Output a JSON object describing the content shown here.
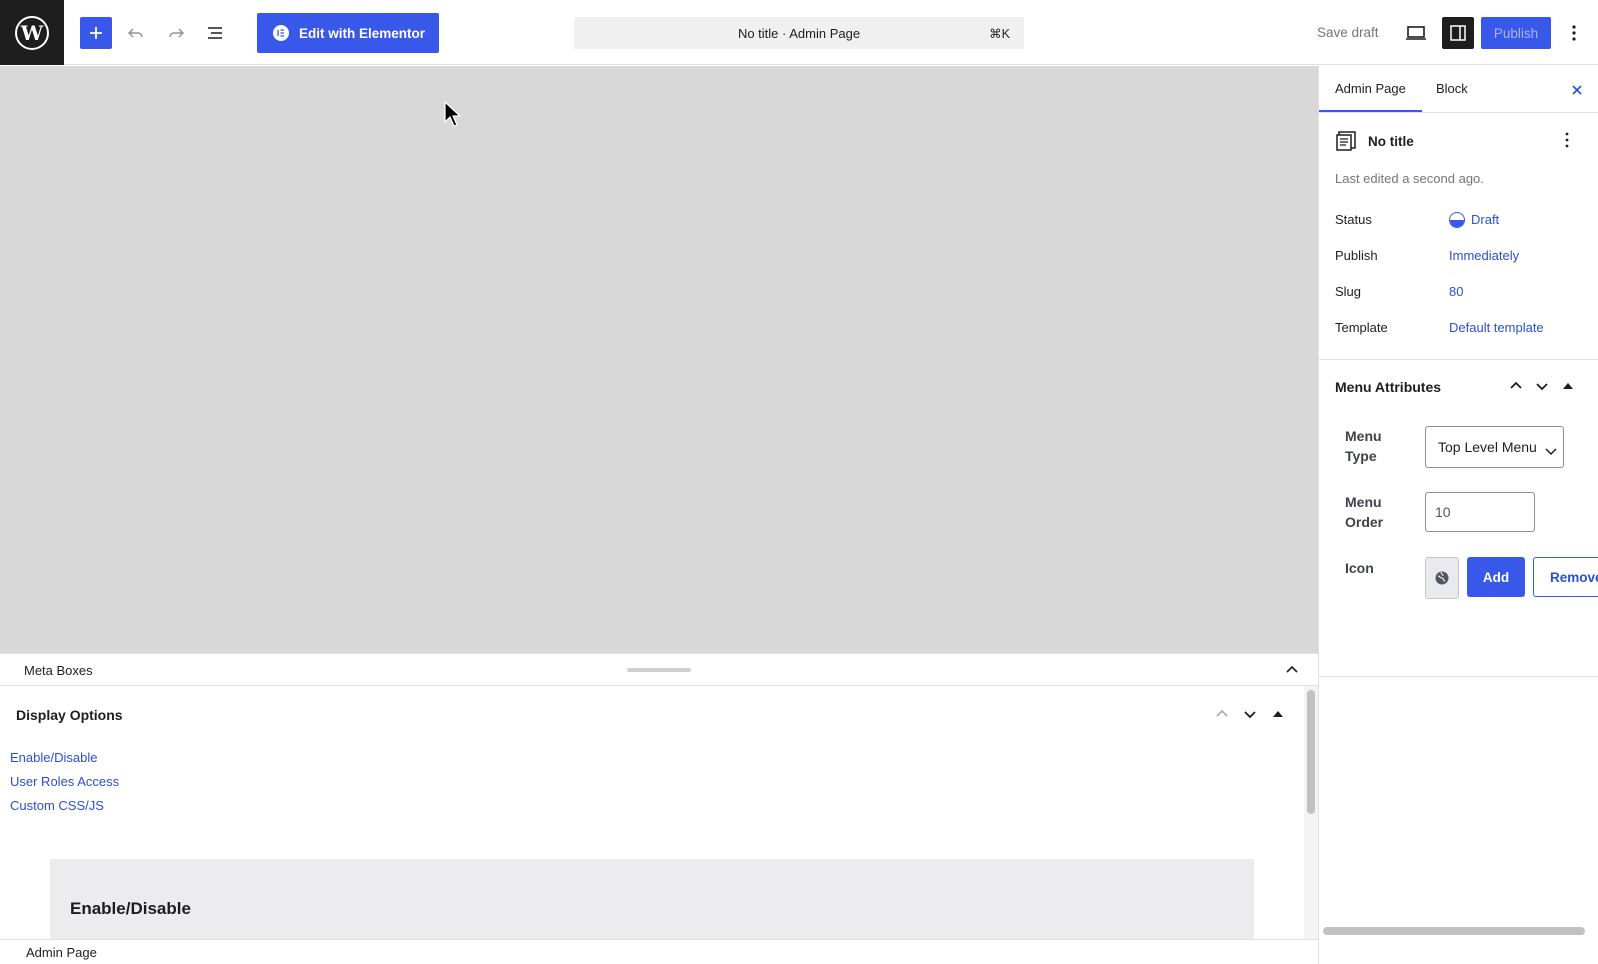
{
  "header": {
    "elementor_label": "Edit with Elementor",
    "command_bar": {
      "title": "No title · Admin Page",
      "shortcut": "⌘K"
    },
    "save_draft": "Save draft",
    "publish": "Publish"
  },
  "meta_boxes": {
    "title": "Meta Boxes",
    "panel": {
      "title": "Display Options",
      "links": [
        "Enable/Disable",
        "User Roles Access",
        "Custom CSS/JS"
      ],
      "section_heading": "Enable/Disable"
    }
  },
  "footer": {
    "breadcrumb": "Admin Page"
  },
  "sidebar": {
    "tabs": [
      "Admin Page",
      "Block"
    ],
    "active_tab": "Admin Page",
    "document": {
      "title": "No title",
      "last_edited": "Last edited a second ago."
    },
    "properties": [
      {
        "label": "Status",
        "value": "Draft"
      },
      {
        "label": "Publish",
        "value": "Immediately"
      },
      {
        "label": "Slug",
        "value": "80"
      },
      {
        "label": "Template",
        "value": "Default template"
      }
    ],
    "menu_attributes": {
      "title": "Menu Attributes",
      "menu_type_label_1": "Menu",
      "menu_type_label_2": "Type",
      "menu_type_value": "Top Level Menu",
      "menu_order_label_1": "Menu",
      "menu_order_label_2": "Order",
      "menu_order_value": "10",
      "icon_label": "Icon",
      "add_label": "Add",
      "remove_label": "Remove"
    }
  },
  "colors": {
    "accent": "#3858e9",
    "link": "#2a4fd0",
    "canvas": "#d8d8d8"
  }
}
